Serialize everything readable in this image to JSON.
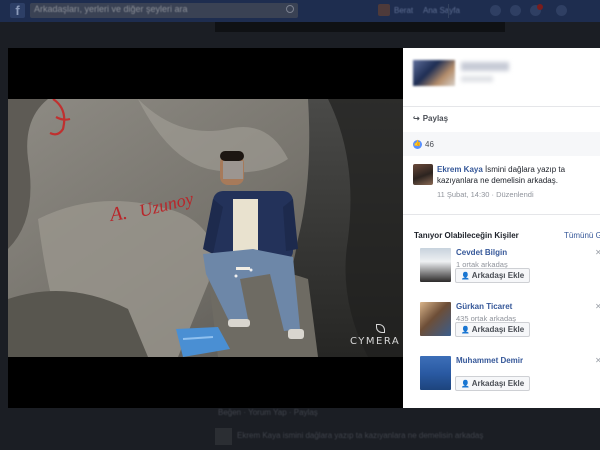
{
  "topbar": {
    "logo": "f",
    "search_text": "Arkadaşları, yerleri ve diğer şeyleri ara",
    "links": [
      "Berat",
      "Ana Sayfa"
    ]
  },
  "background": {
    "line1": "Beğen · Yorum Yap · Paylaş",
    "line2": "Ekrem Kaya ismini dağlara yazıp ta kazıyanlara ne demelisin arkadaş"
  },
  "photo": {
    "graffiti": "A. Uzunoy",
    "watermark": "CYMERA"
  },
  "sidebar": {
    "share_label": "Paylaş",
    "like_count": "46",
    "comment": {
      "author": "Ekrem Kaya",
      "text": "İsmini dağlara yazıp ta kazıyanlara ne demelisin arkadaş.",
      "date": "11 Şubat, 14:30",
      "edited": "Düzenlendi"
    },
    "pymk": {
      "title": "Tanıyor Olabileceğin Kişiler",
      "see_all": "Tümünü Gör",
      "people": [
        {
          "name": "Cevdet Bilgin",
          "mutual": "1 ortak arkadaş",
          "button": "Arkadaşı Ekle"
        },
        {
          "name": "Gürkan Ticaret",
          "mutual": "435 ortak arkadaş",
          "button": "Arkadaşı Ekle"
        },
        {
          "name": "Muhammet Demir",
          "mutual": "",
          "button": "Arkadaşı Ekle"
        }
      ]
    }
  },
  "colors": {
    "link_blue": "#365899",
    "like_blue": "#5890ff",
    "overlay_dark": "#1b1e24",
    "graffiti_red": "#b8262a"
  }
}
